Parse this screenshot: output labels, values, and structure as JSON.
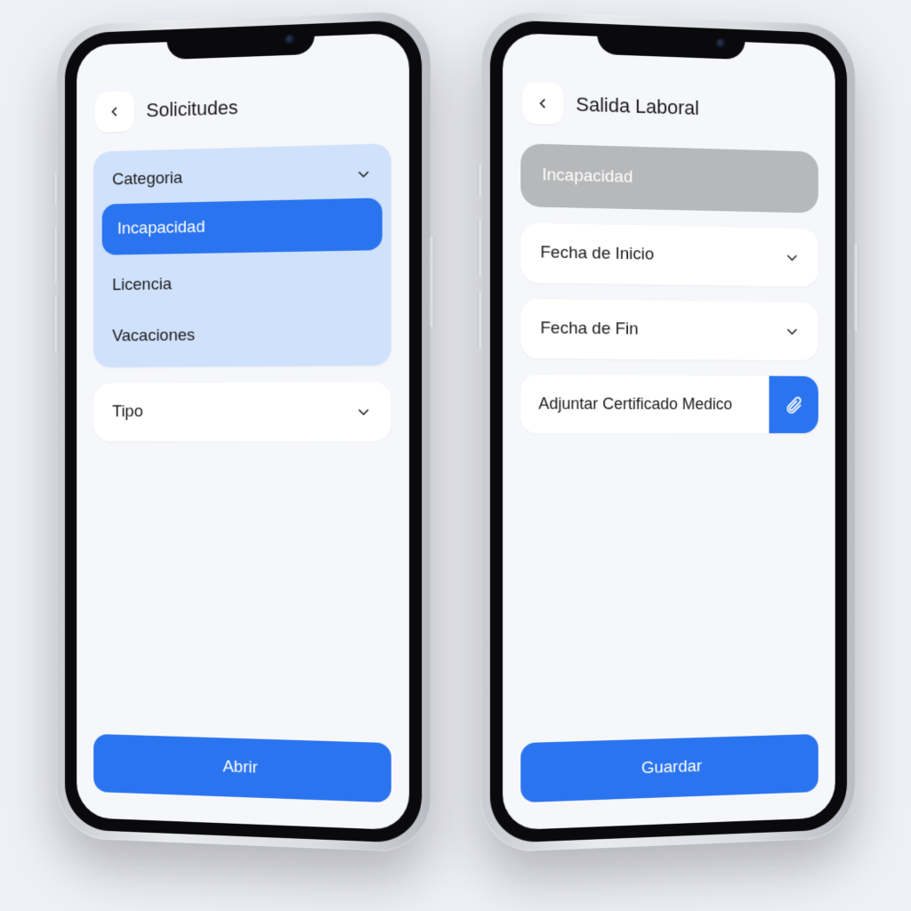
{
  "left": {
    "title": "Solicitudes",
    "category": {
      "label": "Categoria",
      "options": [
        "Incapacidad",
        "Licencia",
        "Vacaciones"
      ],
      "selected": "Incapacidad"
    },
    "tipo_label": "Tipo",
    "primary": "Abrir"
  },
  "right": {
    "title": "Salida Laboral",
    "selected_category": "Incapacidad",
    "fecha_inicio": "Fecha de Inicio",
    "fecha_fin": "Fecha de Fin",
    "attach_label": "Adjuntar Certificado Medico",
    "primary": "Guardar"
  }
}
